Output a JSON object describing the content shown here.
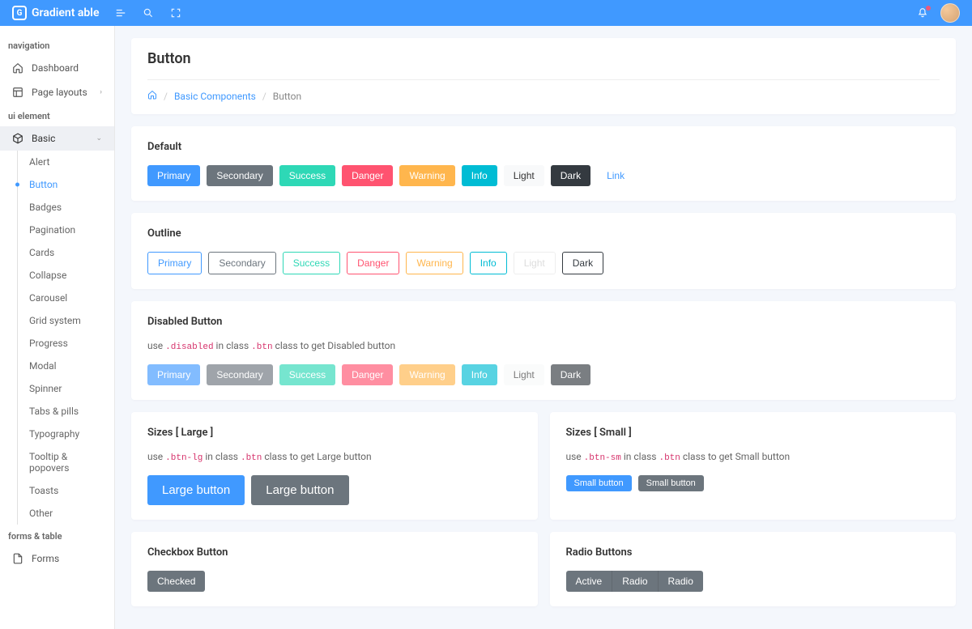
{
  "brand": "Gradient able",
  "header": {
    "notif_count": "1"
  },
  "sidebar": {
    "sec1_title": "navigation",
    "dashboard": "Dashboard",
    "page_layouts": "Page layouts",
    "sec2_title": "ui element",
    "basic": "Basic",
    "basic_items": {
      "alert": "Alert",
      "button": "Button",
      "badges": "Badges",
      "pagination": "Pagination",
      "cards": "Cards",
      "collapse": "Collapse",
      "carousel": "Carousel",
      "grid": "Grid system",
      "progress": "Progress",
      "modal": "Modal",
      "spinner": "Spinner",
      "tabs": "Tabs & pills",
      "typography": "Typography",
      "tooltip": "Tooltip & popovers",
      "toasts": "Toasts",
      "other": "Other"
    },
    "sec3_title": "forms & table",
    "forms": "Forms"
  },
  "page": {
    "title": "Button",
    "breadcrumb": {
      "home": "⌂",
      "comp": "Basic Components",
      "current": "Button"
    }
  },
  "cards": {
    "default": {
      "title": "Default",
      "primary": "Primary",
      "secondary": "Secondary",
      "success": "Success",
      "danger": "Danger",
      "warning": "Warning",
      "info": "Info",
      "light": "Light",
      "dark": "Dark",
      "link": "Link"
    },
    "outline": {
      "title": "Outline",
      "primary": "Primary",
      "secondary": "Secondary",
      "success": "Success",
      "danger": "Danger",
      "warning": "Warning",
      "info": "Info",
      "light": "Light",
      "dark": "Dark"
    },
    "disabled": {
      "title": "Disabled Button",
      "desc1": "use ",
      "code1": ".disabled",
      "desc2": " in class ",
      "code2": ".btn",
      "desc3": " class to get Disabled button",
      "primary": "Primary",
      "secondary": "Secondary",
      "success": "Success",
      "danger": "Danger",
      "warning": "Warning",
      "info": "Info",
      "light": "Light",
      "dark": "Dark"
    },
    "sizes_lg": {
      "title": "Sizes [ Large ]",
      "desc1": "use ",
      "code1": ".btn-lg",
      "desc2": " in class ",
      "code2": ".btn",
      "desc3": " class to get Large button",
      "btn1": "Large button",
      "btn2": "Large button"
    },
    "sizes_sm": {
      "title": "Sizes [ Small ]",
      "desc1": "use ",
      "code1": ".btn-sm",
      "desc2": " in class ",
      "code2": ".btn",
      "desc3": " class to get Small button",
      "btn1": "Small button",
      "btn2": "Small button"
    },
    "checkbox": {
      "title": "Checkbox Button",
      "checked": "Checked"
    },
    "radio": {
      "title": "Radio Buttons",
      "active": "Active",
      "radio1": "Radio",
      "radio2": "Radio"
    }
  }
}
